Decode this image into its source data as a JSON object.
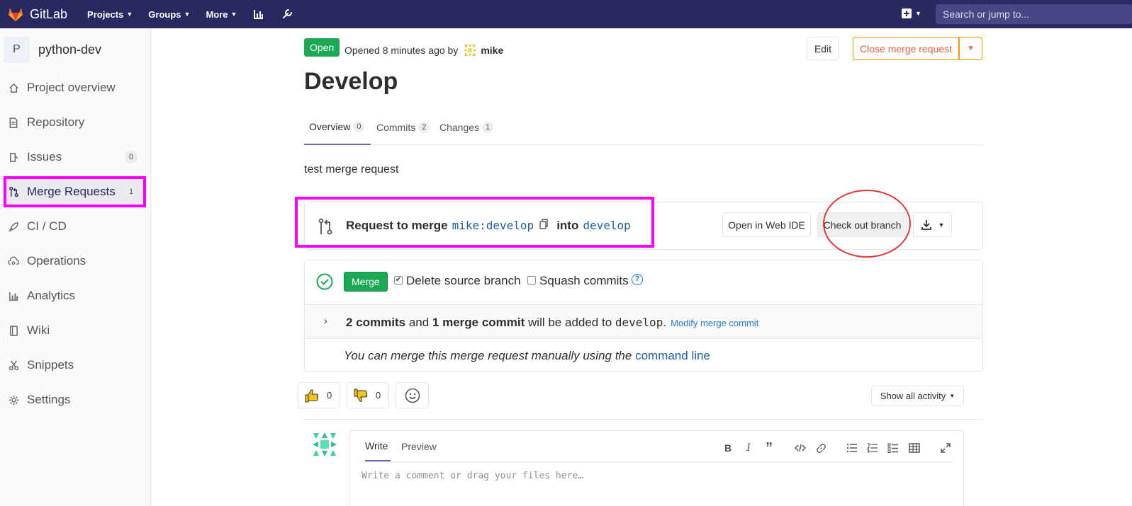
{
  "topbar": {
    "logo_text": "GitLab",
    "nav": [
      "Projects",
      "Groups",
      "More"
    ],
    "search_placeholder": "Search or jump to..."
  },
  "sidebar": {
    "avatar_letter": "P",
    "project_name": "python-dev",
    "items": [
      {
        "label": "Project overview",
        "icon": "home-icon"
      },
      {
        "label": "Repository",
        "icon": "document-icon"
      },
      {
        "label": "Issues",
        "icon": "issues-icon",
        "count": "0"
      },
      {
        "label": "Merge Requests",
        "icon": "git-merge-icon",
        "count": "1"
      },
      {
        "label": "CI / CD",
        "icon": "rocket-icon"
      },
      {
        "label": "Operations",
        "icon": "cloud-gear-icon"
      },
      {
        "label": "Analytics",
        "icon": "chart-icon"
      },
      {
        "label": "Wiki",
        "icon": "book-icon"
      },
      {
        "label": "Snippets",
        "icon": "scissors-icon"
      },
      {
        "label": "Settings",
        "icon": "gear-icon"
      }
    ]
  },
  "header": {
    "status": "Open",
    "opened_text": "Opened 8 minutes ago by",
    "author": "mike",
    "edit_label": "Edit",
    "close_label": "Close merge request",
    "title": "Develop"
  },
  "tabs": [
    {
      "label": "Overview",
      "count": "0"
    },
    {
      "label": "Commits",
      "count": "2"
    },
    {
      "label": "Changes",
      "count": "1"
    }
  ],
  "description": "test merge request",
  "merge_info": {
    "prefix": "Request to merge",
    "source": "mike:develop",
    "into": "into",
    "target": "develop",
    "web_ide_label": "Open in Web IDE",
    "checkout_label": "Check out branch"
  },
  "merge_panel": {
    "merge_label": "Merge",
    "delete_source": "Delete source branch",
    "squash": "Squash commits",
    "commits_bold": "2 commits",
    "and": " and ",
    "merge_commit_bold": "1 merge commit",
    "added_to": " will be added to ",
    "branch": "develop",
    "period": ".",
    "modify_label": "Modify merge commit",
    "manual_text": "You can merge this merge request manually using the ",
    "command_line": "command line"
  },
  "reactions": {
    "thumbs_up": "0",
    "thumbs_down": "0",
    "activity_label": "Show all activity"
  },
  "editor": {
    "write_tab": "Write",
    "preview_tab": "Preview",
    "placeholder": "Write a comment or drag your files here…"
  },
  "colors": {
    "topbar": "#292961",
    "open_green": "#1aaa55",
    "highlight_magenta": "#ff00ff",
    "annotation_red": "#e8363a",
    "close_orange": "#fc9403"
  }
}
